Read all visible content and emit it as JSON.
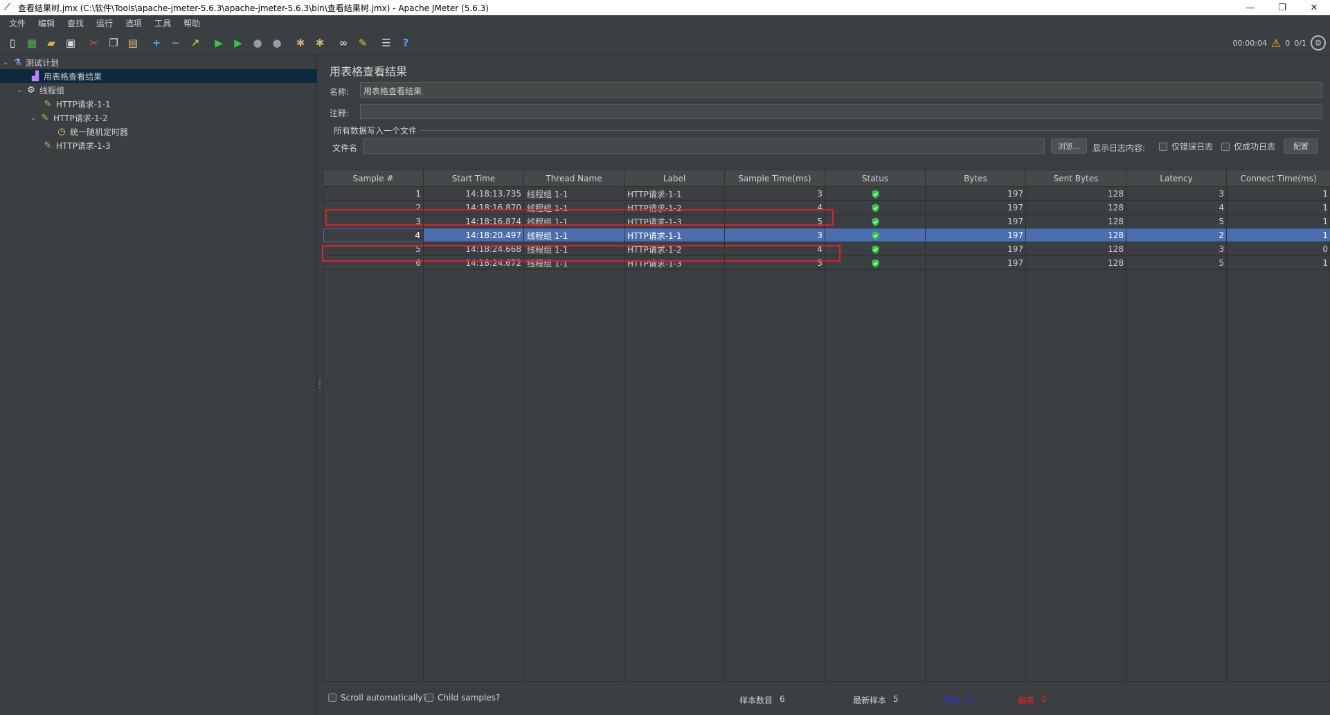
{
  "window": {
    "title": "查看结果树.jmx (C:\\软件\\Tools\\apache-jmeter-5.6.3\\apache-jmeter-5.6.3\\bin\\查看结果树.jmx) - Apache JMeter (5.6.3)",
    "minimize": "—",
    "maximize": "❐",
    "close": "✕"
  },
  "menu": [
    "文件",
    "编辑",
    "查找",
    "运行",
    "选项",
    "工具",
    "帮助"
  ],
  "toolbar": {
    "timer": "00:00:04",
    "warnings": "0",
    "threads": "0/1"
  },
  "tree": [
    {
      "label": "测试计划",
      "icon": "flask-icon",
      "level": 0,
      "expanded": true
    },
    {
      "label": "用表格查看结果",
      "icon": "chart-icon",
      "level": 1,
      "selected": true
    },
    {
      "label": "线程组",
      "icon": "gear-icon",
      "level": 1,
      "expanded": true
    },
    {
      "label": "HTTP请求-1-1",
      "icon": "pen-icon",
      "level": 2
    },
    {
      "label": "HTTP请求-1-2",
      "icon": "pen-icon",
      "level": 2,
      "expanded": true
    },
    {
      "label": "统一随机定时器",
      "icon": "timer-icon",
      "level": 3
    },
    {
      "label": "HTTP请求-1-3",
      "icon": "pen-icon",
      "level": 2
    }
  ],
  "panel": {
    "title": "用表格查看结果",
    "name_label": "名称:",
    "name_value": "用表格查看结果",
    "comment_label": "注释:",
    "comment_value": "",
    "group_title": "所有数据写入一个文件",
    "file_label": "文件名",
    "file_value": "",
    "browse_label": "浏览...",
    "log_label": "显示日志内容:",
    "errors_only": "仅错误日志",
    "success_only": "仅成功日志",
    "config_label": "配置"
  },
  "table": {
    "columns": [
      "Sample #",
      "Start Time",
      "Thread Name",
      "Label",
      "Sample Time(ms)",
      "Status",
      "Bytes",
      "Sent Bytes",
      "Latency",
      "Connect Time(ms)"
    ],
    "rows": [
      {
        "sample": "1",
        "start": "14:18:13.735",
        "thread": "线程组 1-1",
        "label": "HTTP请求-1-1",
        "time": "3",
        "status": "success",
        "bytes": "197",
        "sent": "128",
        "latency": "3",
        "connect": "1"
      },
      {
        "sample": "2",
        "start": "14:18:16.870",
        "thread": "线程组 1-1",
        "label": "HTTP请求-1-2",
        "time": "4",
        "status": "success",
        "bytes": "197",
        "sent": "128",
        "latency": "4",
        "connect": "1"
      },
      {
        "sample": "3",
        "start": "14:18:16.874",
        "thread": "线程组 1-1",
        "label": "HTTP请求-1-3",
        "time": "5",
        "status": "success",
        "bytes": "197",
        "sent": "128",
        "latency": "5",
        "connect": "1"
      },
      {
        "sample": "4",
        "start": "14:18:20.497",
        "thread": "线程组 1-1",
        "label": "HTTP请求-1-1",
        "time": "3",
        "status": "success",
        "bytes": "197",
        "sent": "128",
        "latency": "2",
        "connect": "1",
        "selected": true
      },
      {
        "sample": "5",
        "start": "14:18:24.668",
        "thread": "线程组 1-1",
        "label": "HTTP请求-1-2",
        "time": "4",
        "status": "success",
        "bytes": "197",
        "sent": "128",
        "latency": "3",
        "connect": "0"
      },
      {
        "sample": "6",
        "start": "14:18:24.672",
        "thread": "线程组 1-1",
        "label": "HTTP请求-1-3",
        "time": "5",
        "status": "success",
        "bytes": "197",
        "sent": "128",
        "latency": "5",
        "connect": "1"
      }
    ]
  },
  "footer": {
    "scroll_label": "Scroll automatically?",
    "child_label": "Child samples?",
    "count_label": "样本数目",
    "count_value": "6",
    "latest_label": "最新样本",
    "latest_value": "5",
    "avg_label": "平均",
    "avg_value": "4",
    "dev_label": "偏离",
    "dev_value": "0",
    "avg_color": "#2a2aff",
    "dev_color": "#ff1a1a"
  },
  "colors": {
    "background": "#3c3f41",
    "selection": "#4b6eaf",
    "highlight_box": "#e0202a",
    "success": "#2ecc40"
  }
}
